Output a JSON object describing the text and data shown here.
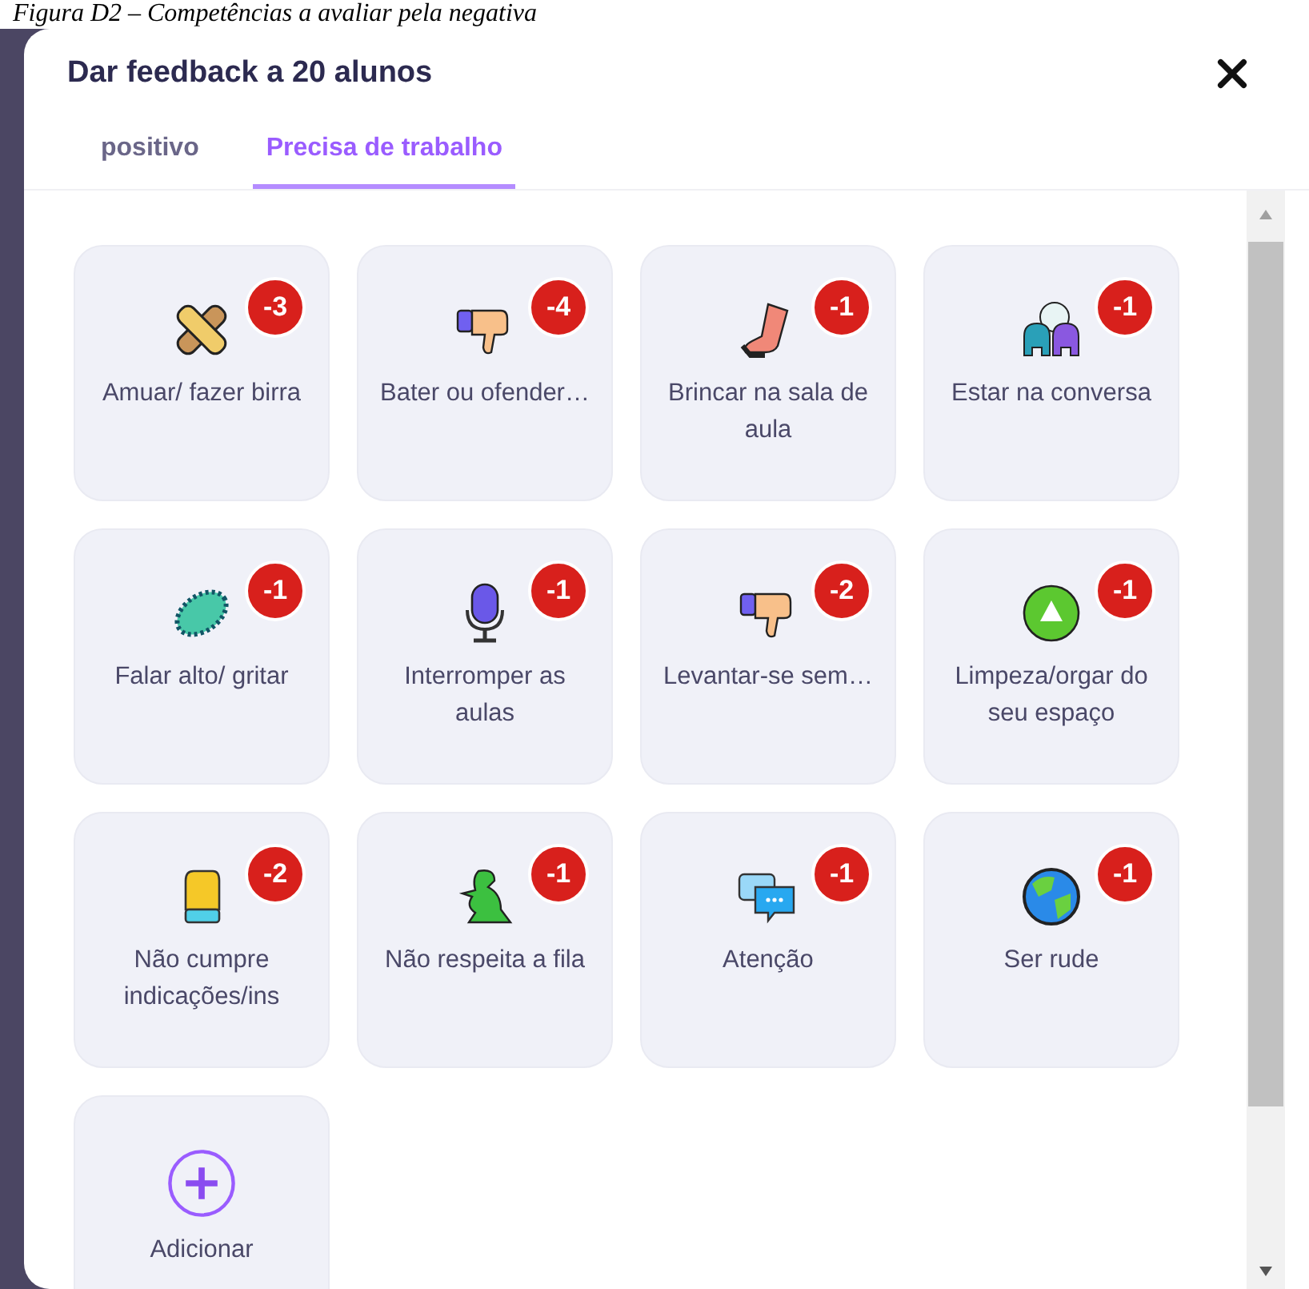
{
  "caption": "Figura D2 – Competências a avaliar pela negativa",
  "dialog": {
    "title": "Dar feedback a 20 alunos"
  },
  "tabs": [
    {
      "label": "positivo",
      "selected": false
    },
    {
      "label": "Precisa de trabalho",
      "selected": true
    }
  ],
  "behaviors": [
    {
      "label": "Amuar/ fazer birra",
      "points": "-3"
    },
    {
      "label": "Bater ou ofender…",
      "points": "-4"
    },
    {
      "label": "Brincar na sala de aula",
      "points": "-1"
    },
    {
      "label": "Estar na conversa",
      "points": "-1"
    },
    {
      "label": "Falar alto/ gritar",
      "points": "-1"
    },
    {
      "label": "Interromper as aulas",
      "points": "-1"
    },
    {
      "label": "Levantar-se sem…",
      "points": "-2"
    },
    {
      "label": "Limpeza/orgar do seu espaço",
      "points": "-1"
    },
    {
      "label": "Não cumpre indicações/ins",
      "points": "-2"
    },
    {
      "label": "Não respeita a fila",
      "points": "-1"
    },
    {
      "label": "Atenção",
      "points": "-1"
    },
    {
      "label": "Ser rude",
      "points": "-1"
    }
  ],
  "add_button": {
    "label": "Adicionar"
  }
}
